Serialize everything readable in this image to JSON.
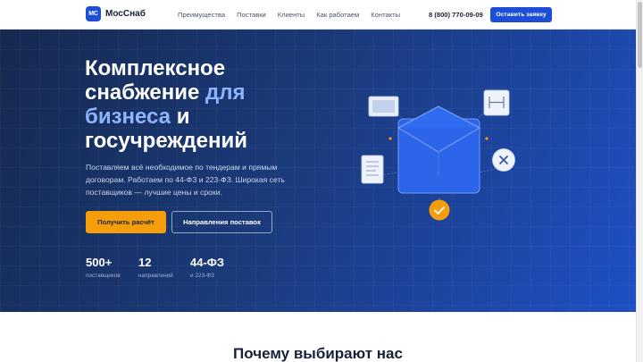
{
  "header": {
    "logo_mark": "МС",
    "brand": "МосСнаб",
    "nav": [
      "Преимущества",
      "Поставки",
      "Клиенты",
      "Как работаем",
      "Контакты"
    ],
    "phone": "8 (800) 770-09-09",
    "cta": "Оставить заявку"
  },
  "hero": {
    "title_line1": "Комплексное",
    "title_line2a": "снабжение ",
    "title_line2b": "для",
    "title_line3a": "бизнеса",
    "title_line3b": " и",
    "title_line4": "госучреждений",
    "description": "Поставляем всё необходимое по тендерам и прямым договорам. Работаем по 44-ФЗ и 223-ФЗ. Широкая сеть поставщиков — лучшие цены и сроки.",
    "primary_button": "Получить расчёт",
    "secondary_button": "Направления поставок",
    "stats": [
      {
        "value": "500+",
        "label": "поставщиков"
      },
      {
        "value": "12",
        "label": "направлений"
      },
      {
        "value": "44-ФЗ",
        "label": "и 223-ФЗ"
      }
    ]
  },
  "next_section": {
    "title": "Почему выбирают нас"
  },
  "colors": {
    "brand_blue": "#1d4ed8",
    "accent_orange": "#f59e0b",
    "hero_dark": "#16294f",
    "hero_light": "#1f4fc4",
    "title_accent": "#8fb4ff"
  },
  "icons": [
    "envelope-icon",
    "document-icon",
    "ruler-icon",
    "close-icon",
    "check-icon"
  ]
}
